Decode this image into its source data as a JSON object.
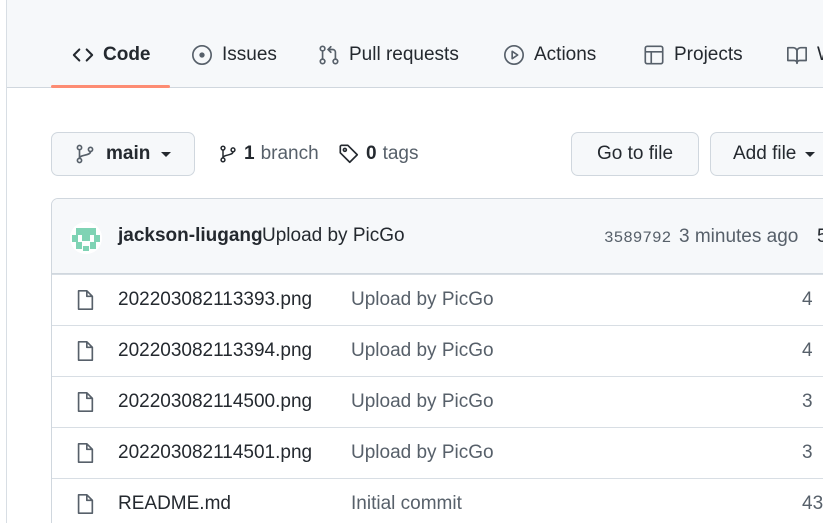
{
  "nav": {
    "tabs": [
      {
        "label": "Code",
        "icon": "code-icon",
        "active": true
      },
      {
        "label": "Issues",
        "icon": "issue-opened-icon"
      },
      {
        "label": "Pull requests",
        "icon": "git-pull-request-icon"
      },
      {
        "label": "Actions",
        "icon": "play-icon"
      },
      {
        "label": "Projects",
        "icon": "table-icon"
      },
      {
        "label": "W",
        "icon": "book-icon"
      }
    ],
    "active_underline_color": "#fd8c73"
  },
  "toolbar": {
    "branch_name": "main",
    "branch_count": "1",
    "branch_label": "branch",
    "tag_count": "0",
    "tag_label": "tags",
    "go_to_file": "Go to file",
    "add_file": "Add file"
  },
  "latest_commit": {
    "author": "jackson-liugang",
    "message": "Upload by PicGo",
    "sha": "3589792",
    "time": "3 minutes ago",
    "trailing": "5"
  },
  "files": [
    {
      "name": "202203082113393.png",
      "message": "Upload by PicGo",
      "age": "4"
    },
    {
      "name": "202203082113394.png",
      "message": "Upload by PicGo",
      "age": "4"
    },
    {
      "name": "202203082114500.png",
      "message": "Upload by PicGo",
      "age": "3"
    },
    {
      "name": "202203082114501.png",
      "message": "Upload by PicGo",
      "age": "3"
    },
    {
      "name": "README.md",
      "message": "Initial commit",
      "age": "43"
    }
  ],
  "colors": {
    "accent": "#fd8c73",
    "border": "#d0d7de",
    "muted": "#57606a",
    "avatar": "#7fd3b4"
  }
}
